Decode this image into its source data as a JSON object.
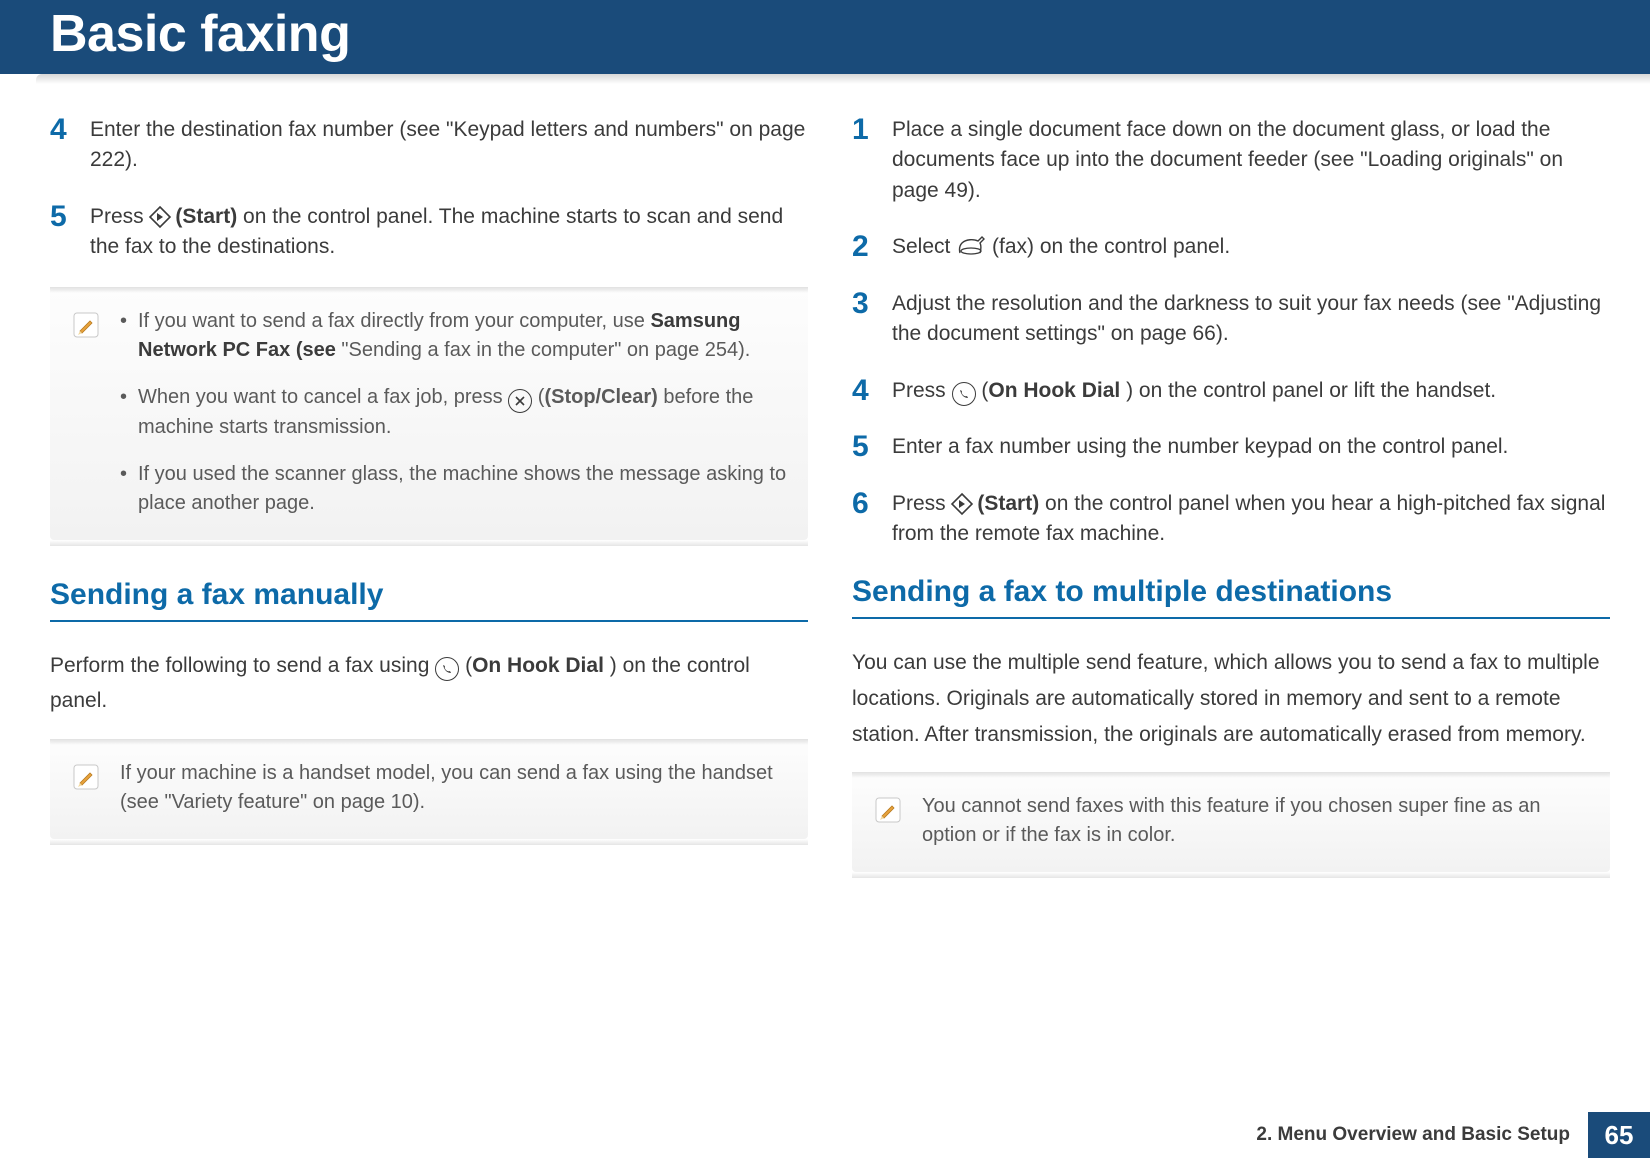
{
  "header": {
    "title": "Basic faxing"
  },
  "left": {
    "steps_a": [
      {
        "num": "4",
        "text_before": "Enter the destination fax number (see \"Keypad letters and numbers\" on page 222).",
        "bold": "",
        "text_after": ""
      },
      {
        "num": "5",
        "text_before": "Press ",
        "icon": "start",
        "bold": "(Start)",
        "text_after": " on the control panel. The machine starts to scan and send the fax to the destinations."
      }
    ],
    "note1": {
      "items": [
        {
          "pre": "If you want to send a fax directly from your computer, use ",
          "bold": "Samsung Network PC Fax (see ",
          "post": "\"Sending a fax in the computer\" on page 254)."
        },
        {
          "pre": "When you want to cancel a fax job, press ",
          "icon": "stop",
          "bold": "(Stop/Clear)",
          "post": " before the machine starts transmission."
        },
        {
          "pre": "If you used the scanner glass, the machine shows the message asking to place another page.",
          "bold": "",
          "post": ""
        }
      ]
    },
    "heading1": "Sending a fax manually",
    "para1_pre": "Perform the following to send a fax using ",
    "para1_bold": "On Hook Dial",
    "para1_post": ") on the control panel.",
    "note2": {
      "text": "If your machine is a handset model, you can send a fax using the handset (see \"Variety feature\" on page 10)."
    }
  },
  "right": {
    "steps_b": [
      {
        "num": "1",
        "text_before": "Place a single document face down on the document glass, or load the documents face up into the document feeder (see \"Loading originals\" on page 49).",
        "bold": "",
        "text_after": ""
      },
      {
        "num": "2",
        "text_before": "Select ",
        "icon": "fax",
        "bold": "",
        "text_after": "(fax) on the control panel."
      },
      {
        "num": "3",
        "text_before": "Adjust the resolution and the darkness to suit your fax needs (see \"Adjusting the document settings\" on page 66).",
        "bold": "",
        "text_after": ""
      },
      {
        "num": "4",
        "text_before": "Press ",
        "icon": "hook",
        "bold": "On Hook Dial",
        "text_after": ") on the control panel or lift the handset."
      },
      {
        "num": "5",
        "text_before": "Enter a fax number using the number keypad on the control panel.",
        "bold": "",
        "text_after": ""
      },
      {
        "num": "6",
        "text_before": "Press ",
        "icon": "start",
        "bold": "(Start)",
        "text_after": " on the control panel when you hear a high-pitched fax signal from the remote fax machine."
      }
    ],
    "heading2": "Sending a fax to multiple destinations",
    "para2": "You can use the multiple send feature, which allows you to send a fax to multiple locations. Originals are automatically stored in memory and sent to a remote station. After transmission, the originals are automatically erased from memory.",
    "note3": {
      "text": "You cannot send faxes with this feature if you chosen super fine as an option or if the fax is in color."
    }
  },
  "footer": {
    "chapter": "2.  Menu Overview and Basic Setup",
    "page": "65"
  }
}
